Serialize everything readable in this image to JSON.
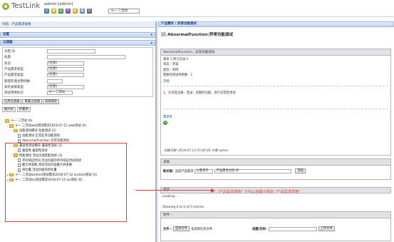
{
  "app": {
    "name": "TestLink",
    "user": "admin [admin]",
    "project_select": "十一 二活动"
  },
  "left": {
    "nav_title": "导航 - 产品需求规格",
    "settings_label": "设置",
    "filters_label": "过滤器",
    "filters": [
      {
        "label": "文档 ID",
        "value": ""
      },
      {
        "label": "标题",
        "value": ""
      },
      {
        "label": "状态",
        "value": "[任意]"
      },
      {
        "label": "产品需求类型",
        "value": "[任意]"
      },
      {
        "label": "产品需求类型",
        "value": "[任意]"
      },
      {
        "label": "期望的测试用例数",
        "value": ""
      },
      {
        "label": "具有关联类型",
        "value": "[任意]"
      },
      {
        "label": "测试用例标识",
        "value": "十一 二活动"
      }
    ],
    "buttons": [
      "应用过滤器",
      "重置过滤器",
      "高级搜索"
    ],
    "tree_tabs": [
      "展开树",
      "折叠树"
    ],
    "tree": [
      {
        "depth": 0,
        "type": "folder",
        "toggle": "-",
        "label": "十一 二活动 (6)"
      },
      {
        "depth": 1,
        "type": "folder",
        "toggle": "-",
        "label": "十一 二活动web测试需求2018-07-12 web测试 (6)"
      },
      {
        "depth": 2,
        "type": "folder",
        "toggle": "-",
        "label": "功能测试模块 功能测试 (2)"
      },
      {
        "depth": 3,
        "type": "doc",
        "toggle": "",
        "label": "功能测试 正常业务功能测试"
      },
      {
        "depth": 3,
        "type": "doc",
        "toggle": "",
        "label": "AbnormalFunction 异常功能测试"
      },
      {
        "depth": 2,
        "type": "folder",
        "toggle": "-",
        "label": "兼容性测试模块 兼容性测试 (1)"
      },
      {
        "depth": 3,
        "type": "doc",
        "toggle": "",
        "label": "兼容性 兼容性测试"
      },
      {
        "depth": 2,
        "type": "folder",
        "toggle": "-",
        "label": "性能测试 活动页面性能测试 (3)"
      },
      {
        "depth": 3,
        "type": "doc",
        "toggle": "",
        "label": "平均响应时间 活动页面的平均响应时间测试"
      },
      {
        "depth": 3,
        "type": "doc",
        "toggle": "",
        "label": "最大并发数 测试活动页面最大并发数"
      },
      {
        "depth": 3,
        "type": "doc",
        "toggle": "",
        "label": "吞吐量 活动页面的吞吐量"
      },
      {
        "depth": 1,
        "type": "folder",
        "toggle": "+",
        "label": "十一 二活动android测试需求2018-07-12 android测试 (0)"
      },
      {
        "depth": 1,
        "type": "folder",
        "toggle": "+",
        "label": "十一 二活动ios测试需求2018-07-12 ios测试 (0)"
      }
    ]
  },
  "right": {
    "header": "产品需求 : 异常功能测试",
    "title": "AbnormalFunction:异常功能测试",
    "spec_head": "AbnormalFunction : 异常功能测试",
    "version": "版本 1 修订记录 1",
    "status": "状态 : 草案",
    "type": "类型 : 用例",
    "expected": "需要的测试用例数 : 1",
    "scope_label": "范围",
    "scope_text": "1、对涉及注册、登录、金额的功能，进行异常性测试",
    "attach_label": "需求单",
    "created": "创建日期: 2018-07-12 05:06:40  作者 admin",
    "relation_head": "关联",
    "relation_label": "新关联:",
    "relation_current": "当前产品需求",
    "relation_type": "父需求于",
    "relation_input": "产品需求文档 ID",
    "relation_add": "添加",
    "req_head": "需求",
    "loading": "Loading...",
    "showing": "Showing 0 to 0 of 0 entries",
    "att_head": "附件 :",
    "file_label": "文件 :",
    "choose_file": "选择文件",
    "no_file": "未选择任何文件",
    "title_label": "标题/名称:",
    "upload": "上传文件"
  },
  "annotation": "\"产品需求规格\" 下可以创建子类的 \"产品需求规格\""
}
